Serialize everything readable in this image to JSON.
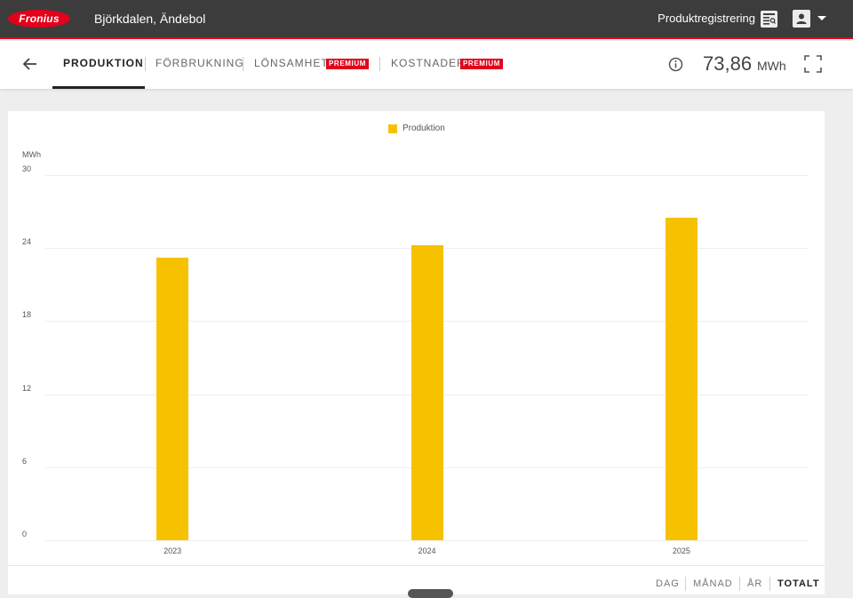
{
  "header": {
    "logo_text": "Fronius",
    "site_name": "Björkdalen, Ändebol",
    "product_registration": "Produktregistrering",
    "icons": [
      "product-registration-icon",
      "user-icon",
      "caret-down-icon"
    ]
  },
  "nav": {
    "tabs": [
      {
        "label": "PRODUKTION",
        "active": true
      },
      {
        "label": "FÖRBRUKNING",
        "active": false
      },
      {
        "label": "LÖNSAMHET",
        "active": false,
        "badge": "PREMIUM"
      },
      {
        "label": "KOSTNADER",
        "active": false,
        "badge": "PREMIUM"
      }
    ],
    "total_value": "73,86",
    "total_unit": "MWh",
    "icons": [
      "back-arrow-icon",
      "info-icon",
      "fullscreen-icon"
    ]
  },
  "colors": {
    "brand_red": "#e3001b",
    "bar_yellow": "#f6c200",
    "header_bg": "#3c3c3c"
  },
  "chart_data": {
    "type": "bar",
    "categories": [
      "2023",
      "2024",
      "2025"
    ],
    "series": [
      {
        "name": "Produktion",
        "values": [
          23.2,
          24.2,
          26.5
        ],
        "color": "#f6c200"
      }
    ],
    "ylabel": "MWh",
    "yticks": [
      "0",
      "6",
      "12",
      "18",
      "24",
      "30"
    ],
    "ylim": [
      0,
      30
    ],
    "grid": true,
    "legend_position": "top-center"
  },
  "period_selector": {
    "options": [
      {
        "label": "DAG",
        "active": false
      },
      {
        "label": "MÅNAD",
        "active": false
      },
      {
        "label": "ÅR",
        "active": false
      },
      {
        "label": "TOTALT",
        "active": true
      }
    ]
  }
}
